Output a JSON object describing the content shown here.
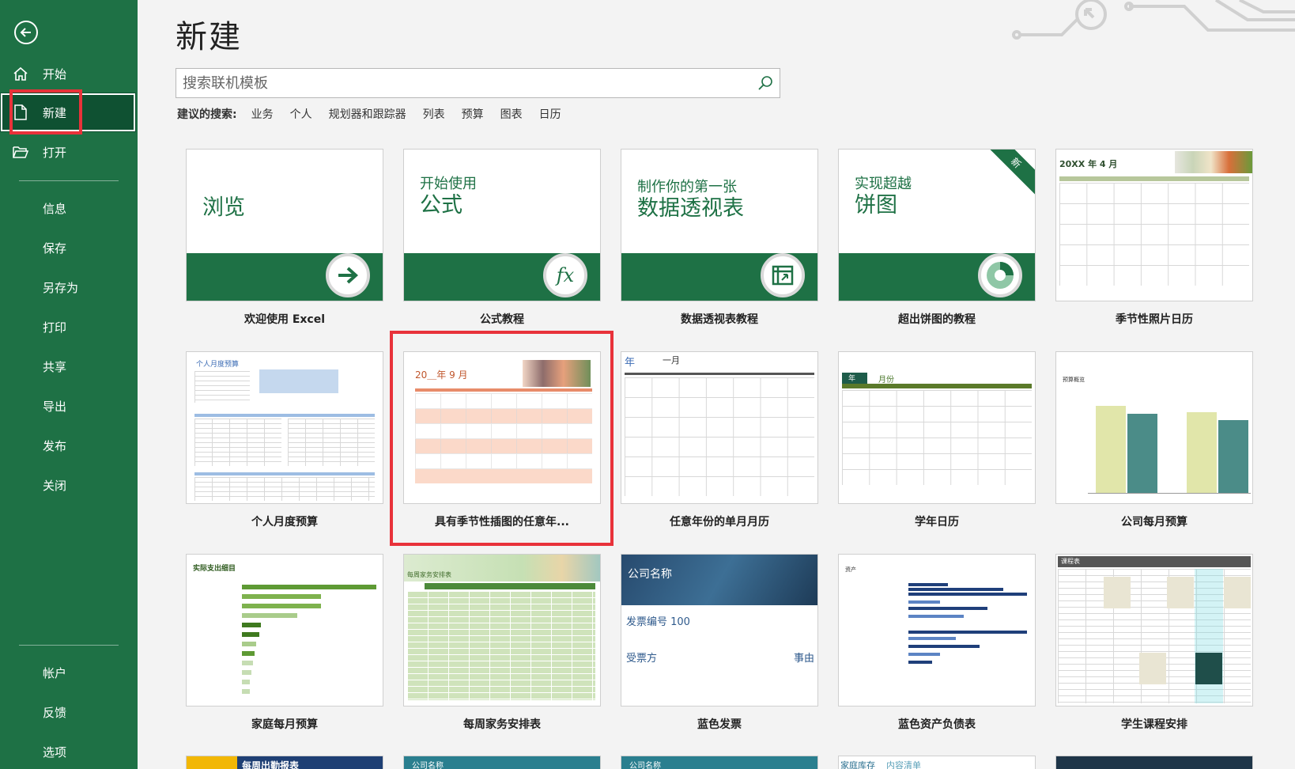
{
  "sidebar": {
    "items": [
      {
        "label": "开始",
        "icon": "home-icon"
      },
      {
        "label": "新建",
        "icon": "new-document-icon",
        "selected": true
      },
      {
        "label": "打开",
        "icon": "folder-open-icon"
      },
      {
        "label": "信息"
      },
      {
        "label": "保存"
      },
      {
        "label": "另存为"
      },
      {
        "label": "打印"
      },
      {
        "label": "共享"
      },
      {
        "label": "导出"
      },
      {
        "label": "发布"
      },
      {
        "label": "关闭"
      },
      {
        "label": "帐户"
      },
      {
        "label": "反馈"
      },
      {
        "label": "选项"
      }
    ]
  },
  "main": {
    "title": "新建",
    "search_placeholder": "搜索联机模板",
    "suggested_label": "建议的搜索:",
    "suggested": [
      "业务",
      "个人",
      "规划器和跟踪器",
      "列表",
      "预算",
      "图表",
      "日历"
    ]
  },
  "templates": [
    {
      "label": "欢迎使用 Excel",
      "tile_text": "浏览",
      "tile_subtext": ""
    },
    {
      "label": "公式教程",
      "tile_text": "公式",
      "tile_subtext": "开始使用"
    },
    {
      "label": "数据透视表教程",
      "tile_text": "数据透视表",
      "tile_subtext": "制作你的第一张"
    },
    {
      "label": "超出饼图的教程",
      "tile_text": "饼图",
      "tile_subtext": "实现超越",
      "badge": "新"
    },
    {
      "label": "季节性照片日历",
      "tile_text": "20XX 年 4 月"
    },
    {
      "label": "个人月度预算",
      "tile_text": "个人月度预算"
    },
    {
      "label": "具有季节性插图的任意年...",
      "tile_text": "20＿年 9 月"
    },
    {
      "label": "任意年份的单月月历",
      "tile_text": "年",
      "tile_subtext": "一月"
    },
    {
      "label": "学年日历",
      "tile_text": "年",
      "tile_subtext": "月份"
    },
    {
      "label": "公司每月预算",
      "tile_text": "预算概览"
    },
    {
      "label": "家庭每月预算",
      "tile_text": "实际支出细目"
    },
    {
      "label": "每周家务安排表",
      "tile_text": "每周家务安排表"
    },
    {
      "label": "蓝色发票",
      "tile_text": "公司名称",
      "tile_subtext": "发票编号 100",
      "tile_extra": "受票方",
      "tile_extra2": "事由"
    },
    {
      "label": "蓝色资产负债表",
      "tile_text": "资产"
    },
    {
      "label": "学生课程安排",
      "tile_text": "课程表"
    }
  ],
  "partial_templates": [
    {
      "tile_text": "每周出勤报表"
    },
    {
      "tile_text": "公司名称"
    },
    {
      "tile_text": "公司名称"
    },
    {
      "tile_text": "家庭库存",
      "tile_subtext": "内容清单"
    },
    {
      "tile_text": ""
    }
  ],
  "colors": {
    "accent": "#1e7145",
    "highlight": "#e8323a",
    "background": "#f3f3f3"
  }
}
